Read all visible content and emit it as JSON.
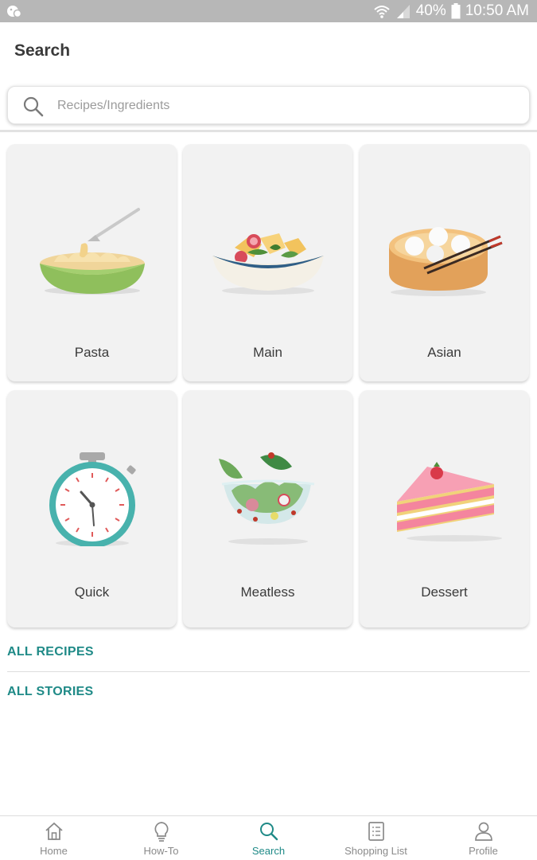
{
  "status_bar": {
    "battery": "40%",
    "time": "10:50 AM",
    "icons": [
      "notification-icon",
      "wifi-icon",
      "signal-icon",
      "battery-icon"
    ]
  },
  "header": {
    "title": "Search"
  },
  "search": {
    "placeholder": "Recipes/Ingredients",
    "value": "",
    "icon": "search-icon"
  },
  "categories": [
    {
      "label": "Pasta",
      "icon": "pasta-bowl-icon"
    },
    {
      "label": "Main",
      "icon": "salad-bowl-icon"
    },
    {
      "label": "Asian",
      "icon": "dumpling-steamer-icon"
    },
    {
      "label": "Quick",
      "icon": "stopwatch-icon"
    },
    {
      "label": "Meatless",
      "icon": "green-salad-icon"
    },
    {
      "label": "Dessert",
      "icon": "cake-slice-icon"
    }
  ],
  "links": {
    "all_recipes": "ALL RECIPES",
    "all_stories": "ALL STORIES"
  },
  "bottom_nav": {
    "items": [
      {
        "label": "Home",
        "icon": "home-icon",
        "active": false
      },
      {
        "label": "How-To",
        "icon": "lightbulb-icon",
        "active": false
      },
      {
        "label": "Search",
        "icon": "search-icon",
        "active": true
      },
      {
        "label": "Shopping List",
        "icon": "checklist-icon",
        "active": false
      },
      {
        "label": "Profile",
        "icon": "person-icon",
        "active": false
      }
    ]
  },
  "colors": {
    "accent": "#1f8a87",
    "status_bar": "#b7b7b7",
    "card_background": "#f2f2f2",
    "inactive_nav": "#8a8a8a"
  }
}
